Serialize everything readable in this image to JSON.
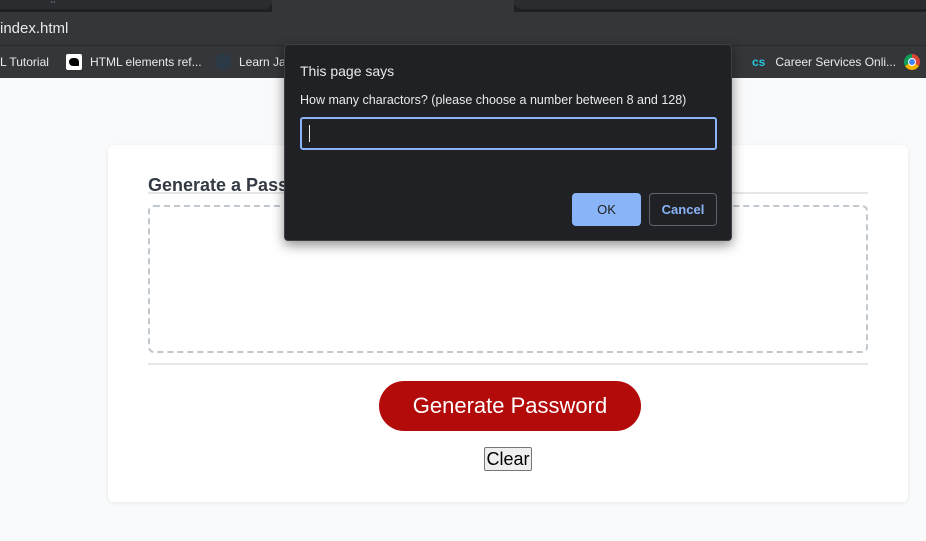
{
  "browser": {
    "url": "index.html",
    "tab_glyph": "··",
    "bookmarks": [
      {
        "label": "L Tutorial",
        "icon": "none"
      },
      {
        "label": "HTML elements ref...",
        "icon": "mdn-icon"
      },
      {
        "label": "Learn Jav",
        "icon": "learn-icon"
      },
      {
        "label": "Career Services Onli...",
        "icon": "cs-icon",
        "icon_text": "cs"
      }
    ],
    "extra_icon": "chrome-icon"
  },
  "page": {
    "title": "Generate a Pass",
    "generate_label": "Generate Password",
    "clear_label": "Clear",
    "accent": "#b30a0a"
  },
  "dialog": {
    "title": "This page says",
    "message": "How many charactors? (please choose a number between 8 and 128)",
    "input_value": "",
    "ok_label": "OK",
    "cancel_label": "Cancel"
  }
}
